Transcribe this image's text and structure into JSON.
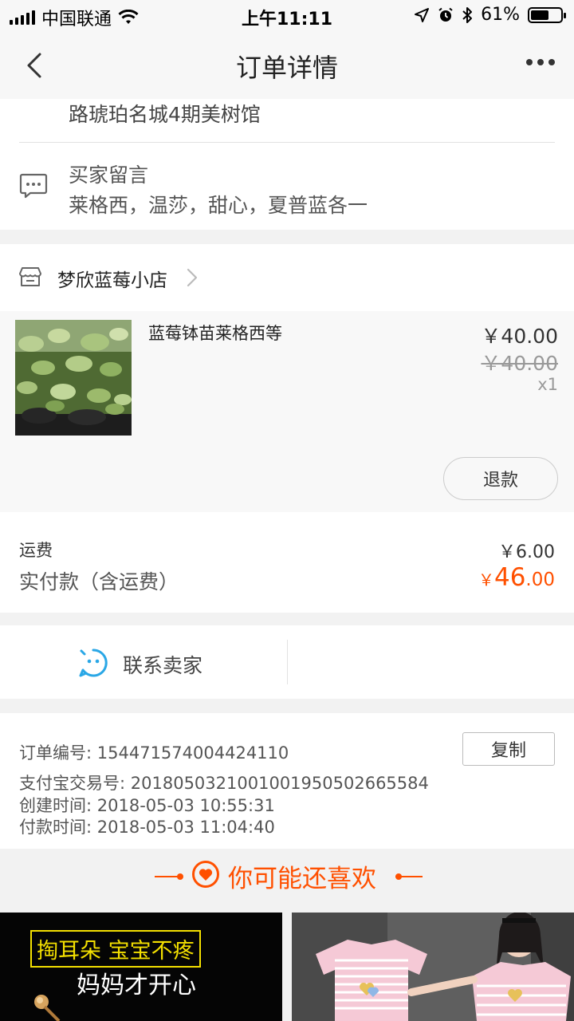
{
  "status_bar": {
    "carrier": "中国联通",
    "time": "上午11:11",
    "battery_percent": "61%",
    "battery_level": 0.61,
    "icons": [
      "signal-icon",
      "wifi-icon",
      "location-arrow-icon",
      "alarm-icon",
      "bluetooth-icon",
      "battery-icon"
    ]
  },
  "nav": {
    "title": "订单详情",
    "back_icon": "chevron-left-icon",
    "more_icon": "more-dots-icon"
  },
  "address": {
    "line": "路琥珀名城4期美树馆"
  },
  "buyer_message": {
    "title": "买家留言",
    "text": "莱格西，温莎，甜心，夏普蓝各一",
    "icon": "chat-bubble-icon"
  },
  "shop": {
    "name": "梦欣蓝莓小店",
    "icon": "store-icon"
  },
  "product": {
    "name": "蓝莓钵苗莱格西等",
    "price": "￥40.00",
    "original_price": "￥40.00",
    "quantity": "x1",
    "refund_label": "退款"
  },
  "totals": {
    "shipping_label": "运费",
    "shipping_value": "￥6.00",
    "paid_label": "实付款（含运费）",
    "paid_symbol": "￥",
    "paid_int": "46",
    "paid_dec": ".00"
  },
  "contact": {
    "label": "联系卖家",
    "icon": "smiley-chat-icon"
  },
  "order_info": {
    "order_no_label": "订单编号:",
    "order_no": "154471574004424110",
    "copy_label": "复制",
    "alipay_label": "支付宝交易号:",
    "alipay_no": "2018050321001001950502665584",
    "created_label": "创建时间:",
    "created": "2018-05-03 10:55:31",
    "paid_label": "付款时间:",
    "paid": "2018-05-03 11:04:40"
  },
  "recommend": {
    "title": "你可能还喜欢",
    "icon": "heart-circle-icon",
    "accent": "#ff5000",
    "tile1_line1": "掏耳朵  宝宝不疼",
    "tile1_line2": "妈妈才开心"
  },
  "colors": {
    "accent_orange": "#ff5000",
    "message_icon": "#555555",
    "contact_icon": "#2aa7e6"
  }
}
